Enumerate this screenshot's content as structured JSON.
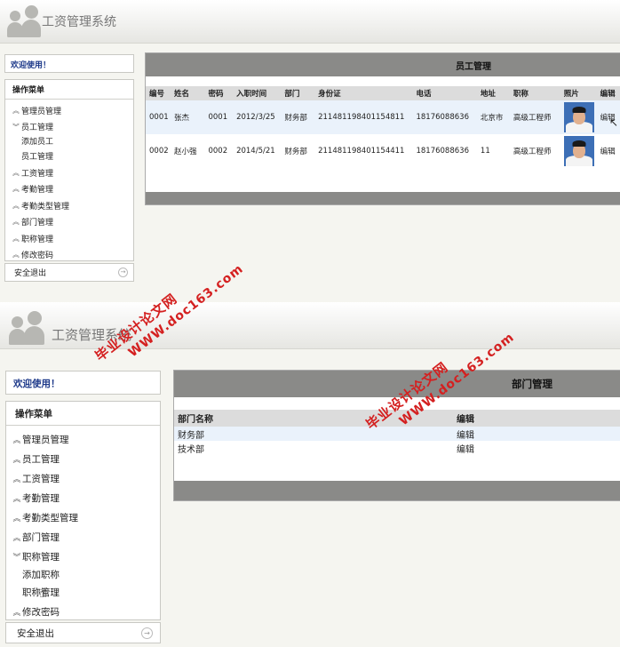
{
  "app": {
    "title": "工资管理系统"
  },
  "watermark": {
    "line1": "毕业设计论文网",
    "line2": "WWW.doc163.com"
  },
  "screen1": {
    "welcome": "欢迎使用！",
    "menu_title": "操作菜单",
    "menu": [
      {
        "label": "管理员管理",
        "chev": "up",
        "subs": []
      },
      {
        "label": "员工管理",
        "chev": "down",
        "subs": [
          "添加员工",
          "员工管理"
        ]
      },
      {
        "label": "工资管理",
        "chev": "up",
        "subs": []
      },
      {
        "label": "考勤管理",
        "chev": "up",
        "subs": []
      },
      {
        "label": "考勤类型管理",
        "chev": "up",
        "subs": []
      },
      {
        "label": "部门管理",
        "chev": "up",
        "subs": []
      },
      {
        "label": "职称管理",
        "chev": "up",
        "subs": []
      },
      {
        "label": "修改密码",
        "chev": "up",
        "subs": []
      }
    ],
    "logout": "安全退出",
    "panel_title": "员工管理",
    "columns": [
      "编号",
      "姓名",
      "密码",
      "入职时间",
      "部门",
      "身份证",
      "电话",
      "地址",
      "职称",
      "照片",
      "编辑"
    ],
    "rows": [
      [
        "0001",
        "张杰",
        "0001",
        "2012/3/25",
        "财务部",
        "211481198401154811",
        "18176088636",
        "北京市",
        "高级工程师",
        "",
        "编辑"
      ],
      [
        "0002",
        "赵小强",
        "0002",
        "2014/5/21",
        "财务部",
        "211481198401154411",
        "18176088636",
        "11",
        "高级工程师",
        "",
        "编辑"
      ]
    ]
  },
  "screen2": {
    "welcome": "欢迎使用！",
    "menu_title": "操作菜单",
    "menu": [
      {
        "label": "管理员管理",
        "chev": "up",
        "subs": []
      },
      {
        "label": "员工管理",
        "chev": "up",
        "subs": []
      },
      {
        "label": "工资管理",
        "chev": "up",
        "subs": []
      },
      {
        "label": "考勤管理",
        "chev": "up",
        "subs": []
      },
      {
        "label": "考勤类型管理",
        "chev": "up",
        "subs": []
      },
      {
        "label": "部门管理",
        "chev": "up",
        "subs": []
      },
      {
        "label": "职称管理",
        "chev": "down",
        "subs": [
          "添加职称",
          "职称管理"
        ]
      },
      {
        "label": "修改密码",
        "chev": "up",
        "subs": []
      }
    ],
    "logout": "安全退出",
    "panel_title": "部门管理",
    "columns": [
      "部门名称",
      "编辑"
    ],
    "rows": [
      [
        "财务部",
        "编辑"
      ],
      [
        "技术部",
        "编辑"
      ]
    ]
  },
  "icons": {
    "expanded": "chevron-down-icon",
    "collapsed": "chevron-up-icon",
    "logout": "arrow-right-icon"
  }
}
